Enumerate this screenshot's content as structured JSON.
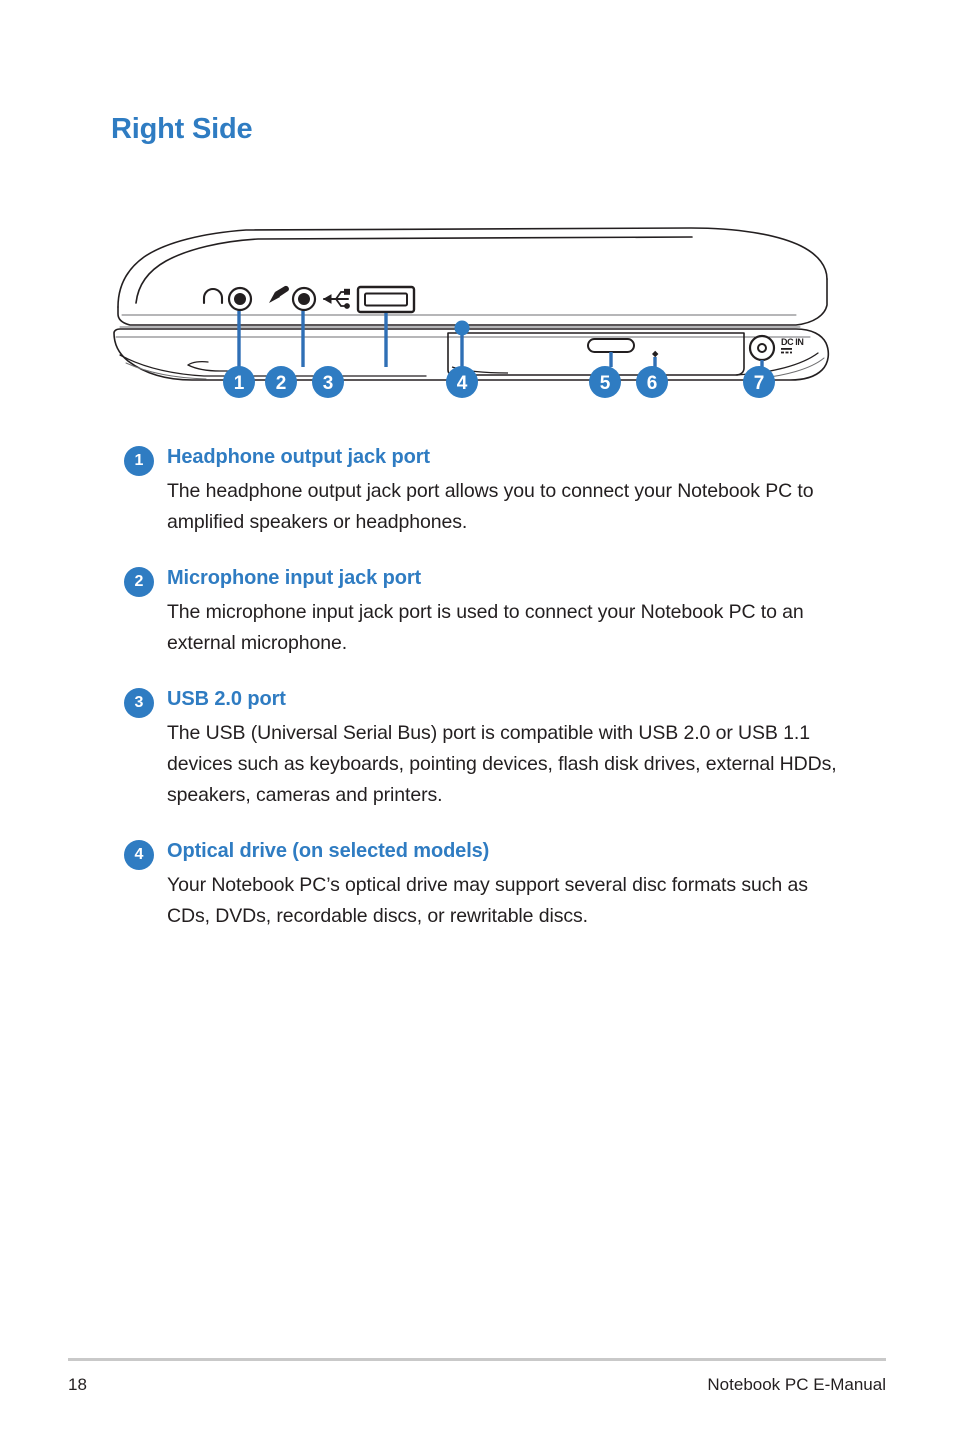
{
  "page": {
    "title": "Right Side",
    "accent_color": "#2f7cc2",
    "text_color": "#231f20"
  },
  "illustration": {
    "name": "notebook-pc-right-side-view",
    "port_labels": {
      "dc_in": "DC IN"
    },
    "callouts": [
      {
        "number": "1",
        "target": "headphone-output-jack"
      },
      {
        "number": "2",
        "target": "microphone-input-jack"
      },
      {
        "number": "3",
        "target": "usb-2-0-port"
      },
      {
        "number": "4",
        "target": "optical-drive"
      },
      {
        "number": "5",
        "target": "optical-drive-eject-button"
      },
      {
        "number": "6",
        "target": "optical-drive-manual-eject-hole"
      },
      {
        "number": "7",
        "target": "power-dc-input-port"
      }
    ]
  },
  "features": [
    {
      "number": "1",
      "title": "Headphone output jack port",
      "body": "The headphone output jack port allows you to connect your Notebook PC to amplified speakers or headphones."
    },
    {
      "number": "2",
      "title": "Microphone input jack port",
      "body": "The microphone input jack port is used to connect your Notebook PC to an external microphone."
    },
    {
      "number": "3",
      "title": "USB 2.0 port",
      "body": "The USB (Universal Serial Bus) port is compatible with USB 2.0 or USB 1.1 devices such as keyboards, pointing devices, flash disk drives, external HDDs, speakers, cameras and printers."
    },
    {
      "number": "4",
      "title": "Optical drive (on selected models)",
      "body": "Your Notebook PC’s optical drive may support several disc formats such as CDs, DVDs, recordable discs, or rewritable discs."
    }
  ],
  "footer": {
    "page_number": "18",
    "manual_name": "Notebook PC E-Manual"
  }
}
